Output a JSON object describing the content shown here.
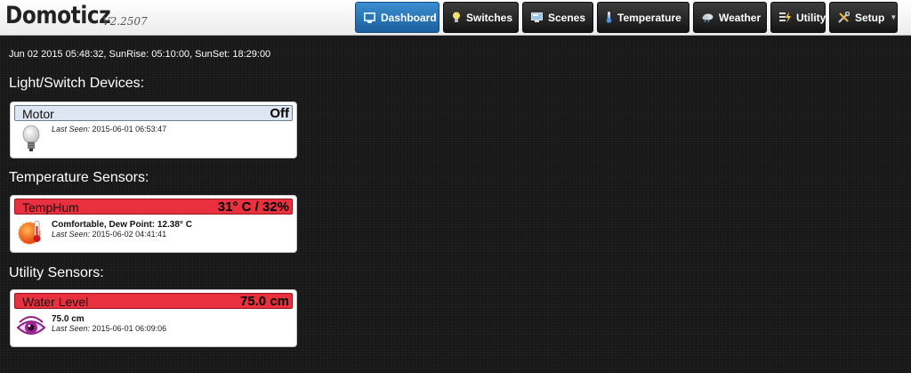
{
  "app": {
    "title": "Domoticz",
    "version": "V2.2507"
  },
  "nav": {
    "items": [
      {
        "label": "Dashboard",
        "icon": "dashboard-icon",
        "active": true
      },
      {
        "label": "Switches",
        "icon": "lightbulb-icon"
      },
      {
        "label": "Scenes",
        "icon": "scenes-icon"
      },
      {
        "label": "Temperature",
        "icon": "thermometer-icon"
      },
      {
        "label": "Weather",
        "icon": "weather-icon"
      },
      {
        "label": "Utility",
        "icon": "utility-icon"
      },
      {
        "label": "Setup",
        "icon": "setup-icon",
        "has_dropdown": true
      }
    ]
  },
  "status": {
    "datetime": "Jun 02 2015 05:48:32, SunRise: 05:10:00, SunSet: 18:29:00"
  },
  "sections": {
    "lights": {
      "title": "Light/Switch Devices:",
      "device": {
        "name": "Motor",
        "value": "Off",
        "icon": "lightbulb-off-icon",
        "last_seen_label": "Last Seen:",
        "last_seen": "2015-06-01 06:53:47"
      }
    },
    "temperature": {
      "title": "Temperature Sensors:",
      "device": {
        "name": "TempHum",
        "value": "31° C / 32%",
        "icon": "temperature-sensor-icon",
        "status": "Comfortable, Dew Point: 12.38° C",
        "last_seen_label": "Last Seen:",
        "last_seen": "2015-06-02 04:41:41"
      }
    },
    "utility": {
      "title": "Utility Sensors:",
      "device": {
        "name": "Water Level",
        "value": "75.0 cm",
        "icon": "eye-icon",
        "status": "75.0 cm",
        "last_seen_label": "Last Seen:",
        "last_seen": "2015-06-01 06:09:06"
      }
    }
  },
  "colors": {
    "nav_active": "#2a78ba",
    "nav_default": "#1f1f1f",
    "bar_off": "#dde6f2",
    "bar_alert": "#e8303f"
  }
}
